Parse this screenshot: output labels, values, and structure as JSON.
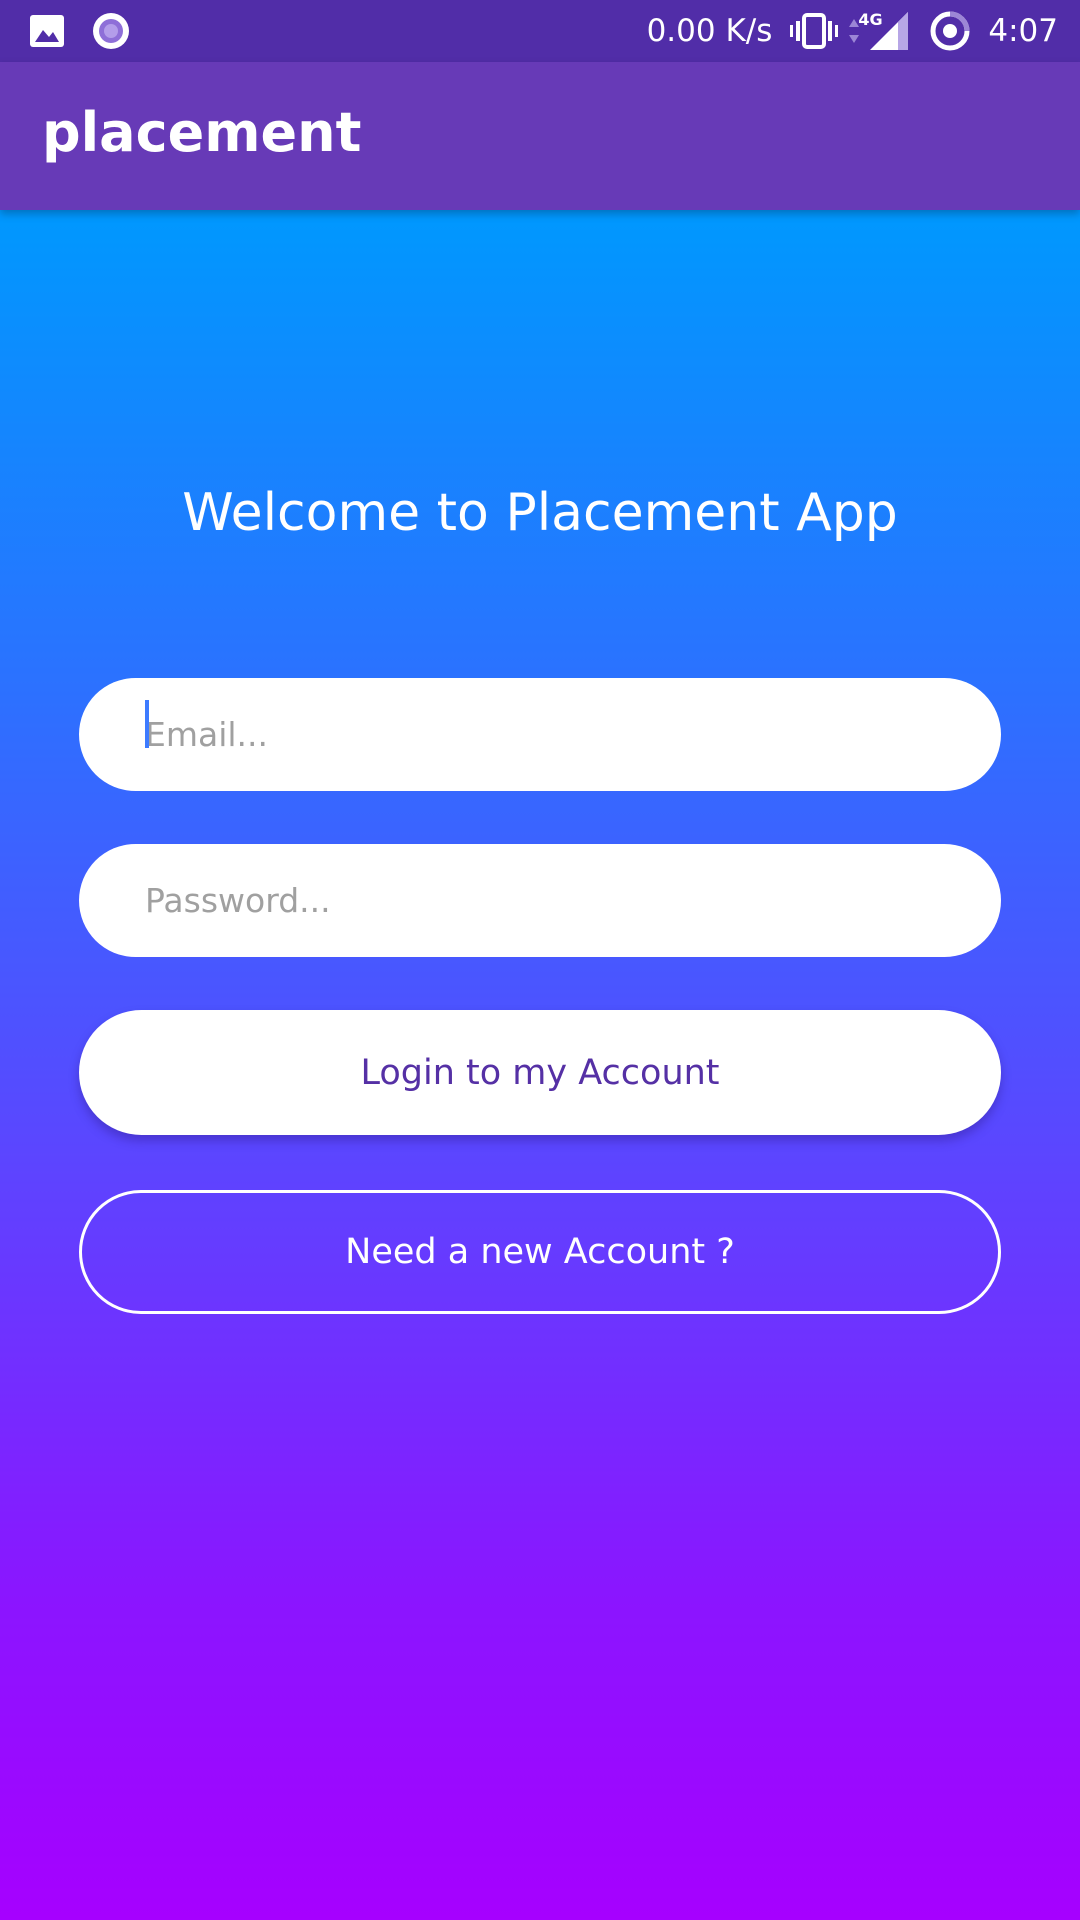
{
  "status_bar": {
    "left_icons": [
      "image-icon",
      "record-icon"
    ],
    "network_speed": "0.00 K/s",
    "network_type": "4G",
    "time": "4:07",
    "right_icons": [
      "vibrate-icon",
      "data-arrows-icon",
      "signal-icon",
      "sync-icon"
    ]
  },
  "app_bar": {
    "title": "placement"
  },
  "main": {
    "welcome": "Welcome to Placement App",
    "email": {
      "placeholder": "Email...",
      "value": ""
    },
    "password": {
      "placeholder": "Password...",
      "value": ""
    },
    "login_label": "Login to my Account",
    "signup_label": "Need a new Account ?"
  },
  "colors": {
    "status_bar": "#512DA8",
    "app_bar": "#673AB7",
    "gradient_top": "#0098FE",
    "gradient_bottom": "#A600FF",
    "login_text": "#5530A5"
  }
}
